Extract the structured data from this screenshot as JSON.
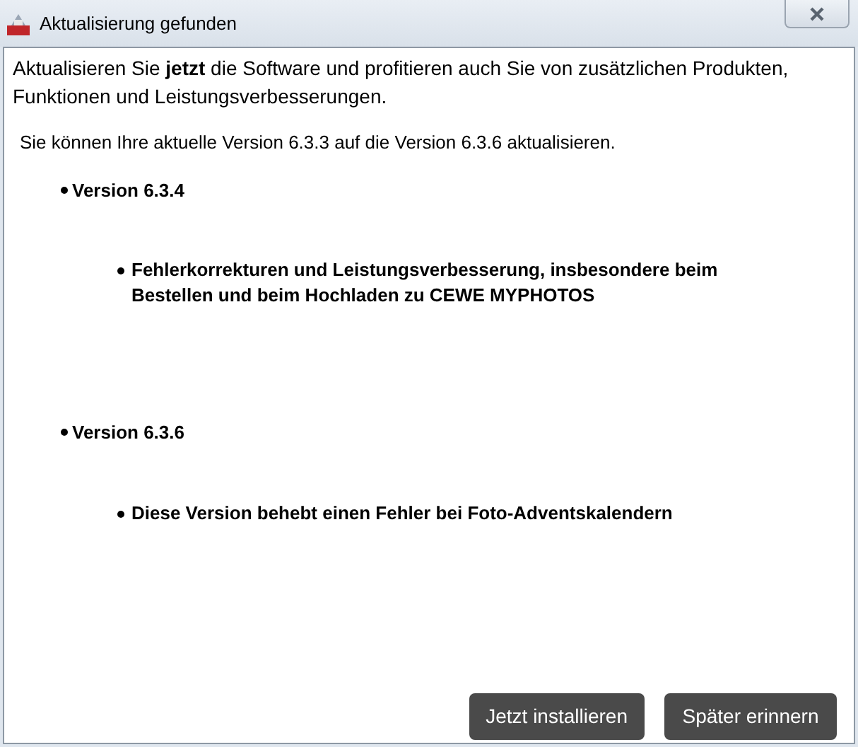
{
  "window": {
    "title": "Aktualisierung gefunden"
  },
  "intro": "Aktualisieren Sie **jetzt** die Software und profitieren auch Sie von zusätzlichen Produkten, Funktionen und Leistungsverbesserungen.",
  "version_info": "Sie können Ihre aktuelle Version 6.3.3 auf die Version 6.3.6 aktualisieren.",
  "versions": [
    {
      "label": "Version 6.3.4",
      "children": [
        {
          "label": "Fehlerkorrekturen und Leistungsverbesserung, insbesondere beim Bestellen und beim Hochladen zu CEWE MYPHOTOS"
        }
      ]
    },
    {
      "label": "Version 6.3.6",
      "children": [
        {
          "label": "Diese Version behebt einen Fehler bei Foto-Adventskalendern"
        }
      ]
    }
  ],
  "buttons": [
    "Jetzt installieren",
    "Später erinnern"
  ]
}
